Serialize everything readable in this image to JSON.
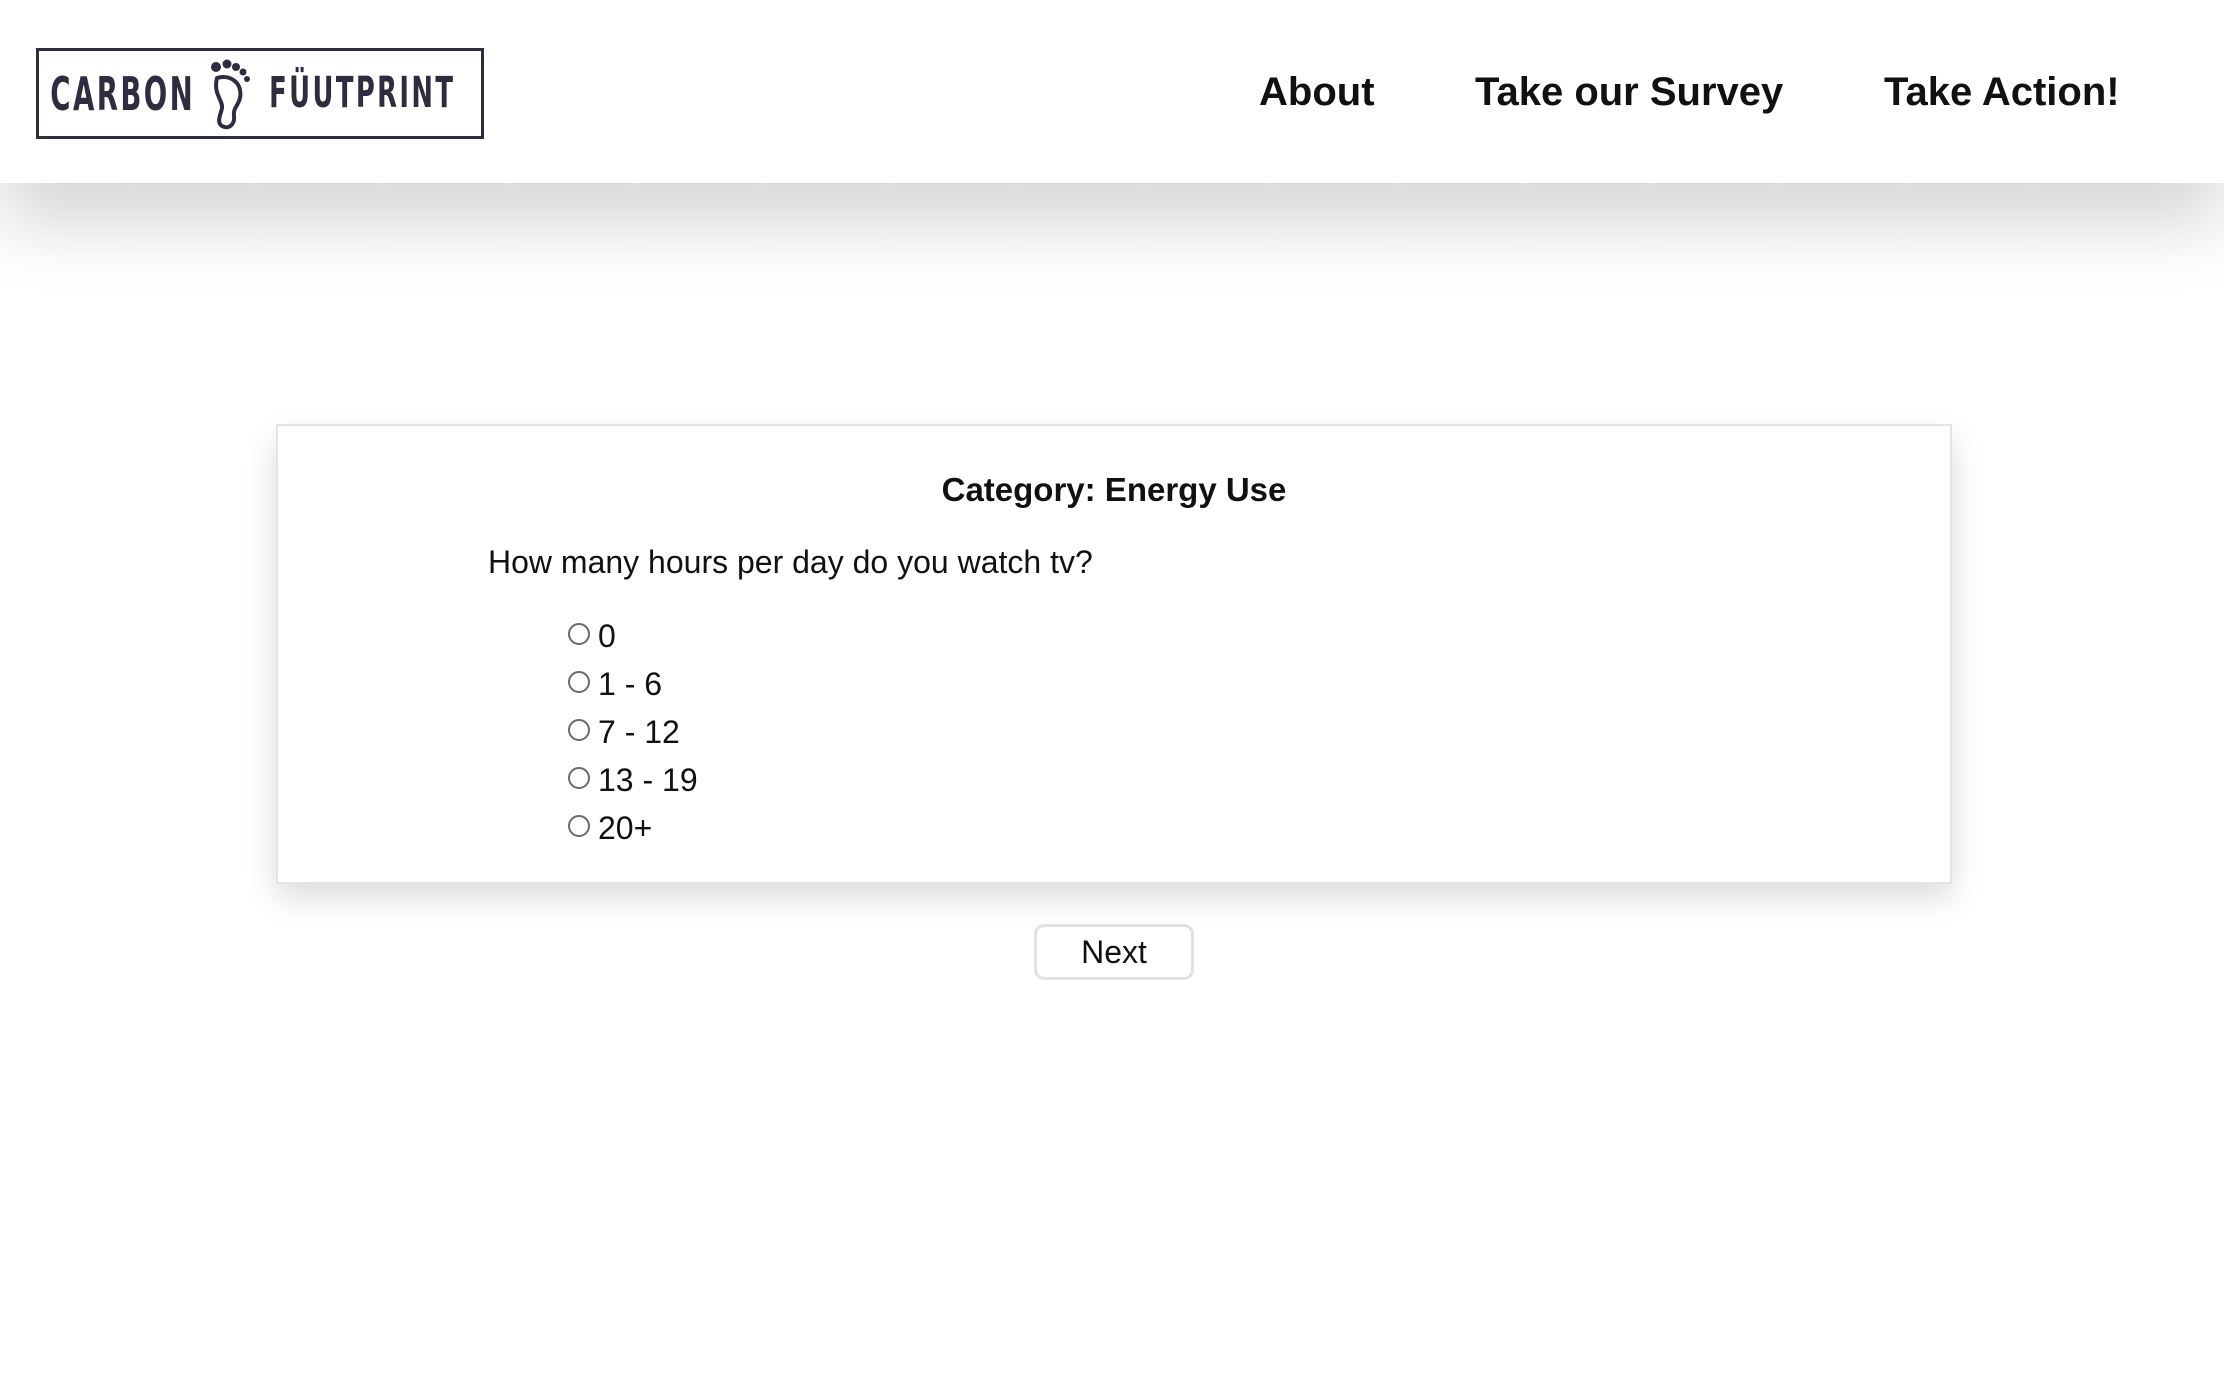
{
  "brand": {
    "logo_text_left": "CARBON",
    "logo_text_right": "FÜUTPRINT",
    "logo_icon": "footprint-icon",
    "logo_color": "#2c2d3f"
  },
  "nav": {
    "items": [
      {
        "label": "About"
      },
      {
        "label": "Take our Survey"
      },
      {
        "label": "Take Action!"
      }
    ]
  },
  "survey": {
    "category": "Category: Energy Use",
    "question": "How many hours per day do you watch tv?",
    "options": [
      {
        "label": "0",
        "selected": false
      },
      {
        "label": "1 - 6",
        "selected": false
      },
      {
        "label": "7 - 12",
        "selected": false
      },
      {
        "label": "13 - 19",
        "selected": false
      },
      {
        "label": "20+",
        "selected": false
      }
    ],
    "next_label": "Next"
  }
}
